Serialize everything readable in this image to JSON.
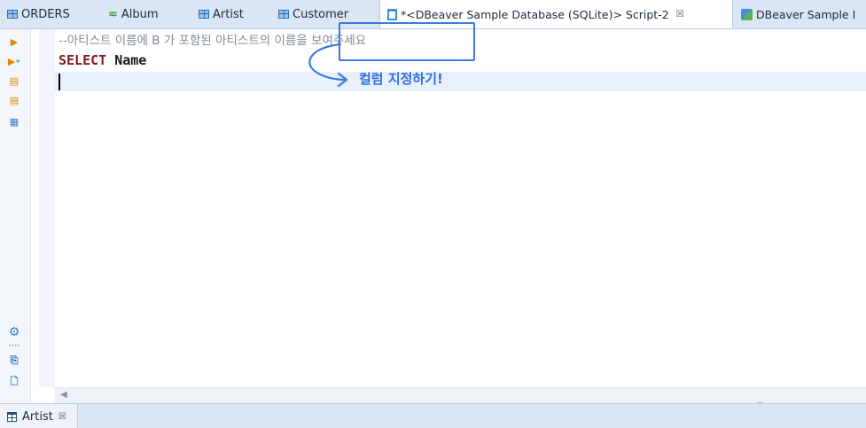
{
  "tabs": [
    {
      "label": "ORDERS",
      "icon": "table-icon"
    },
    {
      "label": "Album",
      "icon": "view-icon"
    },
    {
      "label": "Artist",
      "icon": "table-icon"
    },
    {
      "label": "Customer",
      "icon": "table-icon"
    },
    {
      "label": "*<DBeaver Sample Database (SQLite)> Script-2",
      "icon": "sql-script-icon",
      "active": true,
      "close": "☒"
    },
    {
      "label": "DBeaver Sample I",
      "icon": "database-icon"
    }
  ],
  "editor": {
    "comment_prefix": "--",
    "comment_text": "아티스트 이름에 B  가 포함된 아티스트의 이름을 보여주세요",
    "keyword": "SELECT",
    "identifier": "Name"
  },
  "annotation": {
    "label": "컬럼 지정하기!",
    "color": "#3c7ae0"
  },
  "bottom_tab": {
    "label": "Artist",
    "close": "☒"
  },
  "colors": {
    "keyword": "#7f1a1a",
    "comment": "#7f8a96",
    "tabbar": "#dae6f3",
    "current_line": "#e9f0fb"
  }
}
